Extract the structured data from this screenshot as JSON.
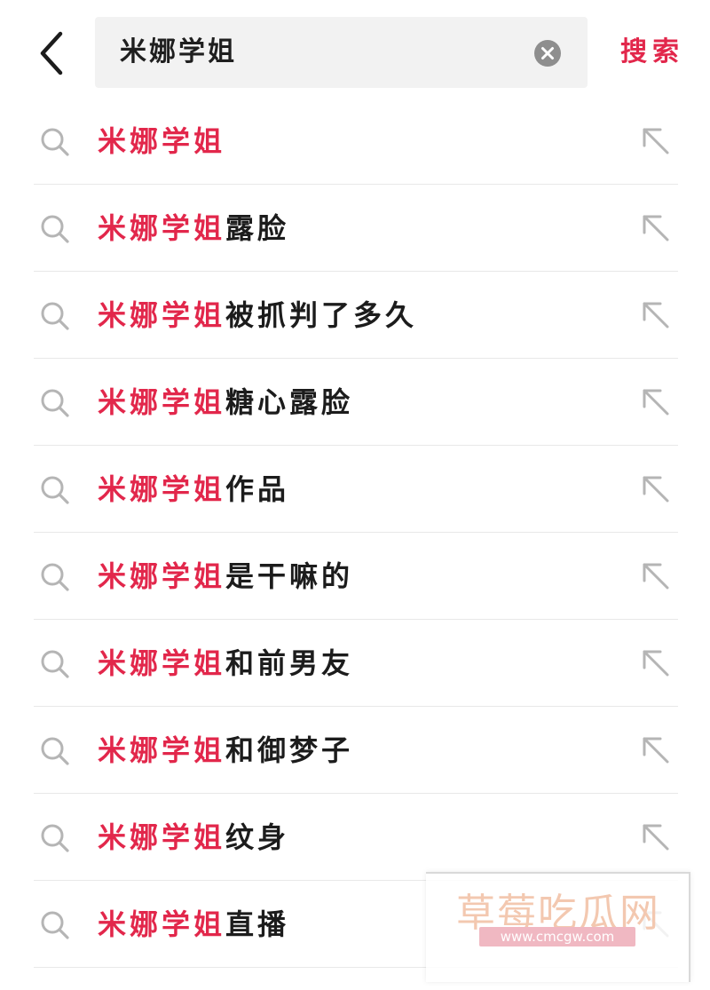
{
  "search": {
    "query": "米娜学姐",
    "submit_label": "搜索"
  },
  "colors": {
    "accent": "#e2274b",
    "text": "#1c1c1c",
    "icon": "#b5b5b5",
    "divider": "#e8e8e8"
  },
  "suggestions": [
    {
      "highlight": "米娜学姐",
      "rest": ""
    },
    {
      "highlight": "米娜学姐",
      "rest": "露脸"
    },
    {
      "highlight": "米娜学姐",
      "rest": "被抓判了多久"
    },
    {
      "highlight": "米娜学姐",
      "rest": "糖心露脸"
    },
    {
      "highlight": "米娜学姐",
      "rest": "作品"
    },
    {
      "highlight": "米娜学姐",
      "rest": "是干嘛的"
    },
    {
      "highlight": "米娜学姐",
      "rest": "和前男友"
    },
    {
      "highlight": "米娜学姐",
      "rest": "和御梦子"
    },
    {
      "highlight": "米娜学姐",
      "rest": "纹身"
    },
    {
      "highlight": "米娜学姐",
      "rest": "直播"
    }
  ],
  "icons": {
    "back": "chevron-left-icon",
    "clear": "clear-circle-icon",
    "row_search": "search-icon",
    "row_fill": "arrow-up-left-icon"
  },
  "watermark": {
    "name": "草莓吃瓜网",
    "url": "www.cmcgw.com"
  }
}
